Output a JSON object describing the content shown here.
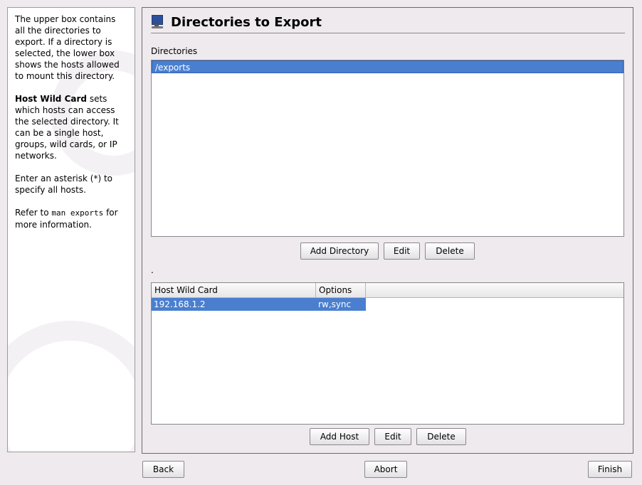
{
  "help": {
    "p1": "The upper box contains all the directories to export. If a directory is selected, the lower box shows the hosts allowed to mount this directory.",
    "p2_bold": "Host Wild Card",
    "p2_rest": " sets which hosts can access the selected directory. It can be a single host, groups, wild cards, or IP networks.",
    "p3": "Enter an asterisk (*) to specify all hosts.",
    "p4_pre": "Refer to ",
    "p4_code": "man exports",
    "p4_post": " for more information."
  },
  "header": {
    "title": "Directories to Export",
    "icon": "monitor-icon"
  },
  "directories": {
    "label": "Directories",
    "items": [
      "/exports"
    ],
    "buttons": {
      "add": "Add Directory",
      "edit": "Edit",
      "delete": "Delete"
    }
  },
  "hosts": {
    "separator": ".",
    "columns": [
      "Host Wild Card",
      "Options"
    ],
    "rows": [
      {
        "host": "192.168.1.2",
        "options": "rw,sync"
      }
    ],
    "buttons": {
      "add": "Add Host",
      "edit": "Edit",
      "delete": "Delete"
    }
  },
  "footer": {
    "back": "Back",
    "abort": "Abort",
    "finish": "Finish"
  },
  "colors": {
    "selection": "#4a7fd0",
    "background": "#eeeaee"
  }
}
